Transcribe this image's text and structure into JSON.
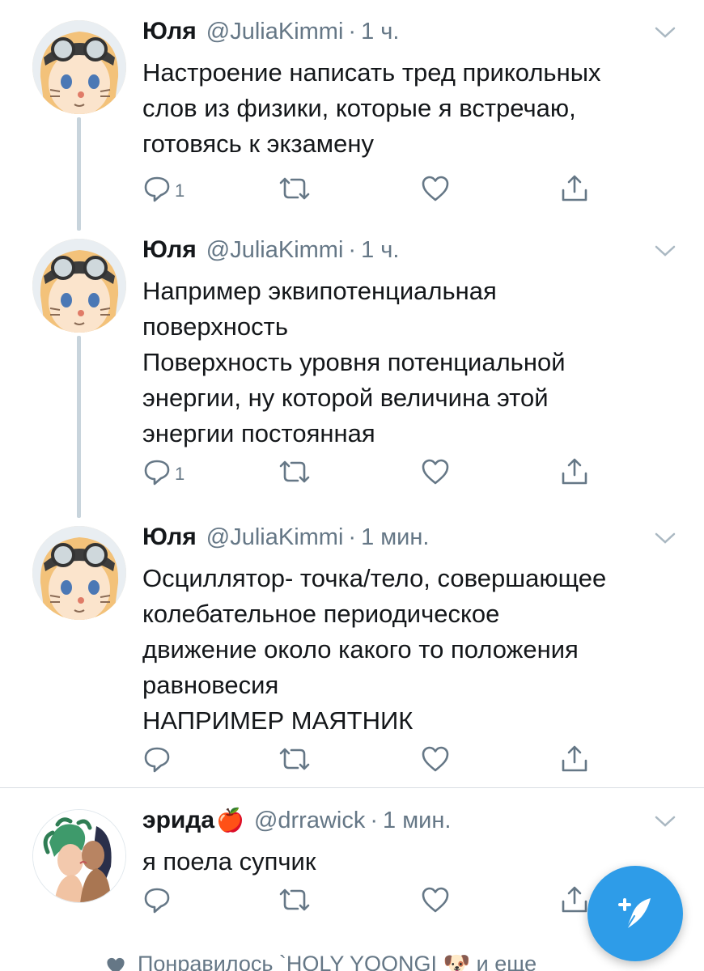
{
  "colors": {
    "accent": "#2e9ce8",
    "secondary_text": "#657786",
    "primary_text": "#14171a",
    "thread_line": "#c8d4dc"
  },
  "tweets": [
    {
      "name": "Юля",
      "handle": "@JuliaKimmi",
      "dot": "·",
      "time": "1 ч.",
      "text": "Настроение написать тред прикольных\nслов из физики, которые я встречаю,\nготовясь к экзамену",
      "reply_count": "1",
      "avatar": "anime-boy-goggles-avatar"
    },
    {
      "name": "Юля",
      "handle": "@JuliaKimmi",
      "dot": "·",
      "time": "1 ч.",
      "text": "Например эквипотенциальная\nповерхность\nПоверхность уровня потенциальной\nэнергии, ну которой величина этой\nэнергии постоянная",
      "reply_count": "1",
      "avatar": "anime-boy-goggles-avatar"
    },
    {
      "name": "Юля",
      "handle": "@JuliaKimmi",
      "dot": "·",
      "time": "1 мин.",
      "text": "Осциллятор- точка/тело, совершающее\nколебательное периодическое\nдвижение около какого то положения\nравновесия\nНАПРИМЕР МАЯТНИК",
      "reply_count": "",
      "avatar": "anime-boy-goggles-avatar"
    },
    {
      "name": "эрида",
      "name_emoji": "🍎",
      "handle": "@drrawick",
      "dot": "·",
      "time": "1 мин.",
      "text": "я поела супчик",
      "reply_count": "",
      "avatar": "medusa-illustration-avatar"
    }
  ],
  "social_context": "Понравилось `HOLY YOONGI 🐶 и еще",
  "fab": {
    "icon": "compose-tweet-icon"
  }
}
